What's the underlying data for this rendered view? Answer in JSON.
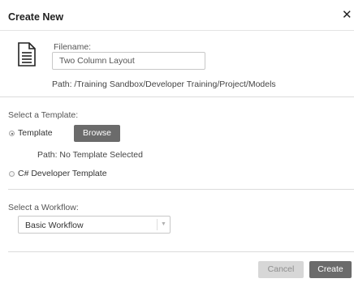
{
  "dialog": {
    "title": "Create New",
    "close_icon": "close-icon"
  },
  "file": {
    "icon": "document-icon",
    "label": "Filename:",
    "value": "Two Column Layout",
    "path": "Path: /Training Sandbox/Developer Training/Project/Models"
  },
  "template": {
    "section_label": "Select a Template:",
    "option_template": "Template",
    "option_template_selected": true,
    "browse_label": "Browse",
    "path": "Path: No Template Selected",
    "option_csharp": "C# Developer Template",
    "option_csharp_selected": false
  },
  "workflow": {
    "section_label": "Select a Workflow:",
    "selected": "Basic Workflow",
    "arrow_icon": "chevron-down-icon"
  },
  "footer": {
    "cancel_label": "Cancel",
    "create_label": "Create"
  },
  "colors": {
    "primary_button": "#6b6b6b",
    "disabled_button": "#d7d7d7"
  }
}
